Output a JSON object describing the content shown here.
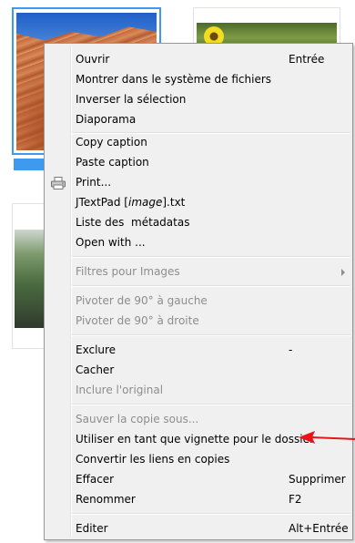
{
  "menu": {
    "items": [
      {
        "label": "Ouvrir",
        "shortcut": "Entrée",
        "disabled": false
      },
      {
        "label": "Montrer dans le système de fichiers",
        "shortcut": "",
        "disabled": false
      },
      {
        "label": "Inverser la sélection",
        "shortcut": "",
        "disabled": false
      },
      {
        "label": "Diaporama",
        "shortcut": "",
        "disabled": false
      },
      {
        "label": "Copy caption",
        "shortcut": "",
        "disabled": false
      },
      {
        "label": "Paste caption",
        "shortcut": "",
        "disabled": false
      },
      {
        "label": "Print...",
        "shortcut": "",
        "disabled": false,
        "icon": "printer-icon"
      },
      {
        "label_pre": "JTextPad [",
        "label_em": "image",
        "label_post": "].txt",
        "disabled": false
      },
      {
        "label": "Liste des  métadatas",
        "shortcut": "",
        "disabled": false
      },
      {
        "label": "Open with ...",
        "shortcut": "",
        "disabled": false
      },
      {
        "label": "Filtres pour Images",
        "shortcut": "",
        "disabled": true,
        "submenu": true
      },
      {
        "label": "Pivoter de 90° à gauche",
        "shortcut": "",
        "disabled": true
      },
      {
        "label": "Pivoter de 90° à droite",
        "shortcut": "",
        "disabled": true
      },
      {
        "label": "Exclure",
        "shortcut": "-",
        "disabled": false
      },
      {
        "label": "Cacher",
        "shortcut": "",
        "disabled": false
      },
      {
        "label": "Inclure l'original",
        "shortcut": "",
        "disabled": true
      },
      {
        "label": "Sauver la copie sous...",
        "shortcut": "",
        "disabled": true
      },
      {
        "label": "Utiliser en tant que vignette pour le dossier",
        "shortcut": "",
        "disabled": false,
        "highlighted_by_annotation": true
      },
      {
        "label": "Convertir les liens en copies",
        "shortcut": "",
        "disabled": false
      },
      {
        "label": "Effacer",
        "shortcut": "Supprimer",
        "disabled": false
      },
      {
        "label": "Renommer",
        "shortcut": "F2",
        "disabled": false
      },
      {
        "label": "Editer",
        "shortcut": "Alt+Entrée",
        "disabled": false
      }
    ]
  },
  "annotation": {
    "color": "#e8141c"
  },
  "colors": {
    "selection": "#3d9aef",
    "disabled_text": "#8d8d8d",
    "menu_bg": "#f0f0f0"
  }
}
